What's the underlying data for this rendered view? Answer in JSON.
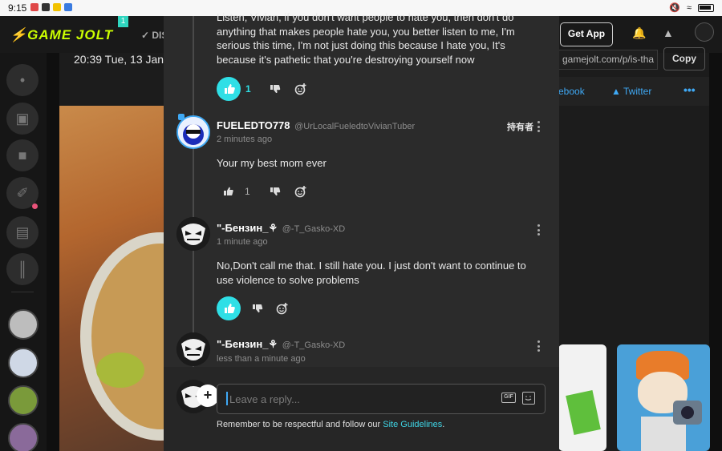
{
  "status_bar": {
    "time": "9:15"
  },
  "nav": {
    "logo": "GAME JOLT",
    "badge_count": "1",
    "discover_label": "DIS",
    "get_app_label": "Get App"
  },
  "background": {
    "date_text": "20:39  Tue, 13 Jan",
    "url_text": "gamejolt.com/p/is-tha",
    "copy_label": "Copy",
    "facebook_label": "ebook",
    "twitter_label": "Twitter",
    "more_label": "•••"
  },
  "comments": [
    {
      "text": "Listen, Vivian, if you don't want people to hate you, then don't do anything that makes people hate you, you better listen to me, I'm serious this time, I'm not just doing this because I hate you, It's because it's pathetic that you're destroying yourself now",
      "likes": "1",
      "liked": true
    },
    {
      "author": "FUELEDTO778",
      "handle": "@UrLocalFueledtoVivianTuber",
      "time": "2 minutes ago",
      "owner_tag": "持有者",
      "text": "Your my best mom ever",
      "likes": "1",
      "liked": false
    },
    {
      "author": "\"-Бензин_⚘",
      "handle": "@-T_Gasko-XD",
      "time": "1 minute ago",
      "text": "No,Don't call me that. I still hate you. I just don't want to continue to use violence to solve problems",
      "likes": "",
      "liked": true
    },
    {
      "author": "\"-Бензин_⚘",
      "handle": "@-T_Gasko-XD",
      "time": "less than a minute ago"
    }
  ],
  "reply": {
    "placeholder": "Leave a reply...",
    "gif_label": "GIF",
    "guidelines_prefix": "Remember to be respectful and follow our ",
    "guidelines_link": "Site Guidelines",
    "guidelines_suffix": "."
  },
  "colors": {
    "accent_cyan": "#2fdfe6",
    "link_blue": "#3fa9f5",
    "logo_green": "#ccff00"
  }
}
